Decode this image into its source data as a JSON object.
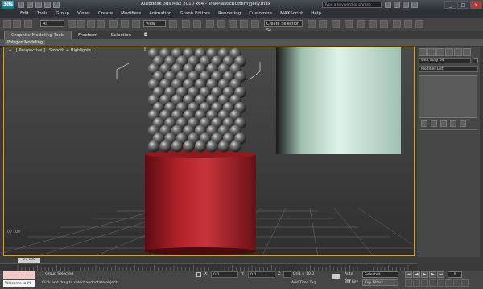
{
  "titlebar": {
    "logo": "3ds",
    "title": "Autodesk 3ds Max 2010 x64 - TrakPlasticButterflyJelly.max",
    "search_placeholder": "Type a keyword or phrase",
    "window_controls": [
      "_",
      "□",
      "×"
    ]
  },
  "menu": {
    "items": [
      "Edit",
      "Tools",
      "Group",
      "Views",
      "Create",
      "Modifiers",
      "Animation",
      "Graph Editors",
      "Rendering",
      "Customize",
      "MAXScript",
      "Help"
    ]
  },
  "toolbar": {
    "selection_filter": "All",
    "reference_coord": "View",
    "named_selection": "Create Selection Se"
  },
  "ribbon": {
    "tabs": [
      "Graphite Modeling Tools",
      "Freeform",
      "Selection"
    ],
    "sub_tab": "Polygon Modeling"
  },
  "viewport": {
    "label": "[ + ] [ Perspective ] [ Smooth + Highlights ]",
    "stat": "0 / 100",
    "cylinder_color": "#b0222a",
    "sphere_color": "#6a6a6a",
    "bg_panel_color": "#cfe8dd"
  },
  "command_panel": {
    "object_name": "shot assy 04",
    "modifier_list": "Modifier List"
  },
  "timeline": {
    "slider": "0 / 100"
  },
  "status": {
    "maxscript_line1": "",
    "maxscript_line2": "Welcome to M",
    "selection": "1 Group Selected",
    "prompt": "Click and drag to select and rotate objects",
    "x_label": "X:",
    "x_value": "0.0",
    "y_label": "Y:",
    "y_value": "0.0",
    "z_label": "Z:",
    "z_value": "0.0",
    "grid": "Grid = 10.0",
    "add_time_tag": "Add Time Tag",
    "auto_key": "Auto Key",
    "set_key": "Set Key",
    "key_mode": "Selected",
    "key_filters": "Key Filters...",
    "current_frame": "0"
  }
}
